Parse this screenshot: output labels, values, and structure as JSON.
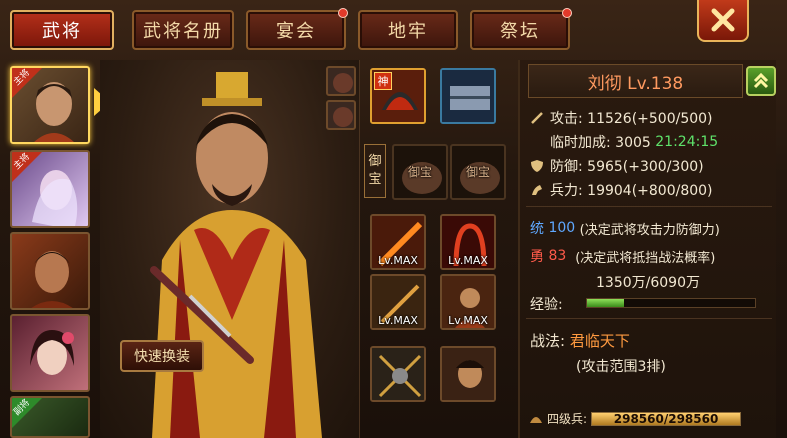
{
  "tabs": [
    {
      "label": "武将",
      "active": true,
      "dot": false
    },
    {
      "label": "武将名册",
      "active": false,
      "dot": false
    },
    {
      "label": "宴会",
      "active": false,
      "dot": true
    },
    {
      "label": "地牢",
      "active": false,
      "dot": false
    },
    {
      "label": "祭坛",
      "active": false,
      "dot": true
    }
  ],
  "avatars": [
    {
      "tag": "主将",
      "selected": true
    },
    {
      "tag": "主将",
      "selected": false
    },
    {
      "tag": "",
      "selected": false
    },
    {
      "tag": "",
      "selected": false
    },
    {
      "tag": "副将",
      "selected": false
    }
  ],
  "portrait": {
    "swap_label": "快速换装"
  },
  "equip": {
    "god_badge": "神",
    "treasure_label": [
      "御",
      "宝"
    ],
    "treasure_slot_text": "御宝",
    "max_label": "Lv.MAX"
  },
  "hero": {
    "name": "刘彻 Lv.138"
  },
  "stats": {
    "attack": "攻击: 11526(+500/500)",
    "temp_bonus_label": "临时加成: 3005",
    "temp_timer": "21:24:15",
    "defense": "防御: 5965(+300/300)",
    "troops": "兵力: 19904(+800/800)",
    "command_label": "统",
    "command_value": "100",
    "command_desc": "(决定武将攻击力防御力)",
    "valor_label": "勇",
    "valor_value": "83",
    "valor_desc": "(决定武将抵挡战法概率)",
    "xp_label": "经验:",
    "xp_text": "1350万/6090万",
    "xp_fraction": 0.22,
    "skill_label": "战法:",
    "skill_name": "君临天下",
    "skill_desc": "(攻击范围3排)",
    "troop_type": "四级兵:",
    "troop_text": "298560/298560",
    "troop_fraction": 1.0
  },
  "colors": {
    "accent": "#b5301a",
    "gold": "#ffcf40",
    "green": "#5fe26a",
    "blue": "#5fa8ff",
    "red": "#ff5a4a"
  }
}
